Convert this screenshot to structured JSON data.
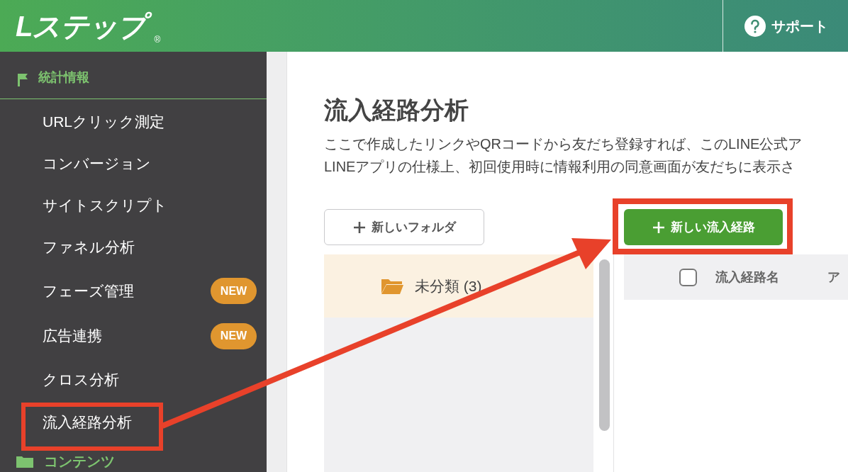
{
  "header": {
    "logo": "Lステップ",
    "logo_mark": "®",
    "support": "サポート"
  },
  "sidebar": {
    "section": "統計情報",
    "items": [
      {
        "label": "URLクリック測定"
      },
      {
        "label": "コンバージョン"
      },
      {
        "label": "サイトスクリプト"
      },
      {
        "label": "ファネル分析"
      },
      {
        "label": "フェーズ管理",
        "badge": "NEW"
      },
      {
        "label": "広告連携",
        "badge": "NEW"
      },
      {
        "label": "クロス分析"
      },
      {
        "label": "流入経路分析"
      }
    ],
    "next_section": "コンテンツ"
  },
  "main": {
    "title": "流入経路分析",
    "description": [
      "ここで作成したリンクやQRコードから友だち登録すれば、このLINE公式ア",
      "LINEアプリの仕様上、初回使用時に情報利用の同意画面が友だちに表示さ"
    ],
    "new_folder_button": "新しいフォルダ",
    "new_route_button": "新しい流入経路",
    "folders": [
      {
        "label": "未分類 (3)",
        "selected": true
      }
    ],
    "table": {
      "checked": false,
      "columns": [
        "流入経路名",
        "ア"
      ]
    }
  }
}
